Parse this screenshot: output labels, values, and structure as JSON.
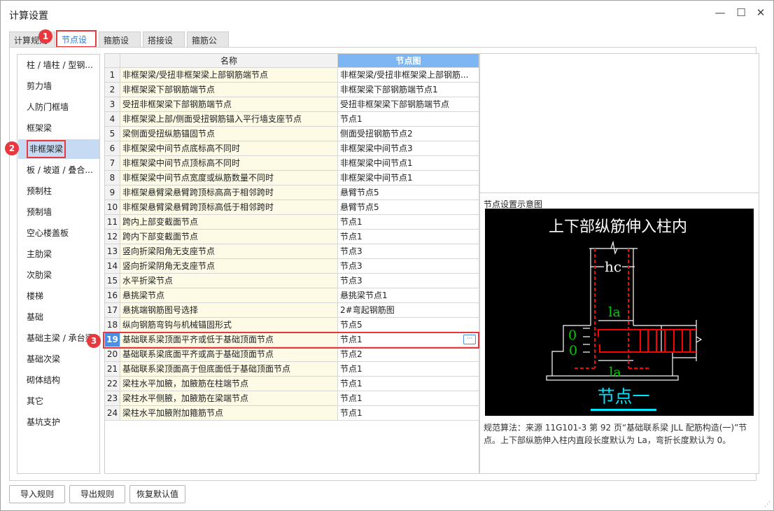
{
  "window": {
    "title": "计算设置",
    "minimize": "—",
    "maximize": "☐",
    "close": "✕"
  },
  "tabs": [
    {
      "label": "计算规则"
    },
    {
      "label": "节点设置"
    },
    {
      "label": "箍筋设置"
    },
    {
      "label": "搭接设置"
    },
    {
      "label": "箍筋公式"
    }
  ],
  "badges": [
    "1",
    "2",
    "3"
  ],
  "sidebar": {
    "items": [
      "柱 / 墙柱 / 型钢...",
      "剪力墙",
      "人防门框墙",
      "框架梁",
      "非框架梁",
      "板 / 坡道 / 叠合...",
      "预制柱",
      "预制墙",
      "空心楼盖板",
      "主肋梁",
      "次肋梁",
      "楼梯",
      "基础",
      "基础主梁 / 承台梁",
      "基础次梁",
      "砌体结构",
      "其它",
      "基坑支护"
    ],
    "selected": 4
  },
  "table": {
    "headers": [
      "",
      "名称",
      "节点图"
    ],
    "selected_row": 19,
    "rows": [
      [
        "1",
        "非框架梁/受扭非框架梁上部钢筋端节点",
        "非框架梁/受扭非框架梁上部钢筋..."
      ],
      [
        "2",
        "非框架梁下部钢筋端节点",
        "非框架梁下部钢筋端节点1"
      ],
      [
        "3",
        "受扭非框架梁下部钢筋端节点",
        "受扭非框架梁下部钢筋端节点"
      ],
      [
        "4",
        "非框架梁上部/侧面受扭钢筋锚入平行墙支座节点",
        "节点1"
      ],
      [
        "5",
        "梁侧面受扭纵筋锚固节点",
        "侧面受扭钢筋节点2"
      ],
      [
        "6",
        "非框架梁中间节点底标高不同时",
        "非框架梁中间节点3"
      ],
      [
        "7",
        "非框架梁中间节点顶标高不同时",
        "非框架梁中间节点1"
      ],
      [
        "8",
        "非框架梁中间节点宽度或纵筋数量不同时",
        "非框架梁中间节点1"
      ],
      [
        "9",
        "非框架悬臂梁悬臂跨顶标高高于相邻跨时",
        "悬臂节点5"
      ],
      [
        "10",
        "非框架悬臂梁悬臂跨顶标高低于相邻跨时",
        "悬臂节点5"
      ],
      [
        "11",
        "跨内上部变截面节点",
        "节点1"
      ],
      [
        "12",
        "跨内下部变截面节点",
        "节点1"
      ],
      [
        "13",
        "竖向折梁阳角无支座节点",
        "节点3"
      ],
      [
        "14",
        "竖向折梁阴角无支座节点",
        "节点3"
      ],
      [
        "15",
        "水平折梁节点",
        "节点3"
      ],
      [
        "16",
        "悬挑梁节点",
        "悬挑梁节点1"
      ],
      [
        "17",
        "悬挑端钢筋图号选择",
        "2#弯起钢筋图"
      ],
      [
        "18",
        "纵向钢筋弯钩与机械锚固形式",
        "节点5"
      ],
      [
        "19",
        "基础联系梁顶面平齐或低于基础顶面节点",
        "节点1"
      ],
      [
        "20",
        "基础联系梁底面平齐或高于基础顶面节点",
        "节点2"
      ],
      [
        "21",
        "基础联系梁顶面高于但底面低于基础顶面节点",
        "节点1"
      ],
      [
        "22",
        "梁柱水平加腋，加腋筋在柱端节点",
        "节点1"
      ],
      [
        "23",
        "梁柱水平侧腋，加腋筋在梁端节点",
        "节点1"
      ],
      [
        "24",
        "梁柱水平加腋附加箍筋节点",
        "节点1"
      ]
    ],
    "ellipsis_button": "···"
  },
  "preview": {
    "label": "节点设置示意图",
    "diagram_title": "上下部纵筋伸入柱内",
    "hc": "hc",
    "la_top": "la",
    "la_bottom": "la",
    "zero_top": "0",
    "zero_bottom": "0",
    "node_name": "节点一",
    "description": "规范算法：来源 11G101-3 第 92 页“基础联系梁 JLL 配筋构造(一)”节点。上下部纵筋伸入柱内直段长度默认为 La，弯折长度默认为 0。"
  },
  "footer": {
    "import": "导入规则",
    "export": "导出规则",
    "restore": "恢复默认值"
  },
  "colors": {
    "accent": "#2a7ad6",
    "highlight": "#e8383d",
    "header_blue": "#7db6f2",
    "rebar": "#ff0000",
    "dim_text": "#00cc00",
    "node_text": "#00e5ff"
  }
}
